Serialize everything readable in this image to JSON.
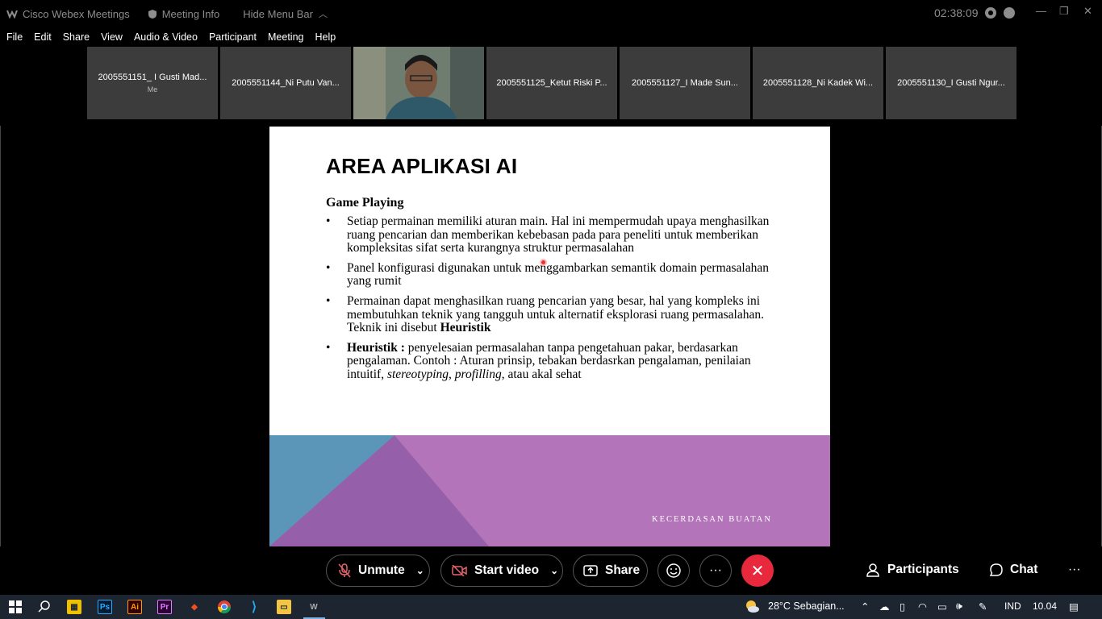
{
  "titlebar": {
    "app_name": "Cisco Webex Meetings",
    "meeting_info": "Meeting Info",
    "hide_menu": "Hide Menu Bar",
    "clock": "02:38:09"
  },
  "menu": [
    "File",
    "Edit",
    "Share",
    "View",
    "Audio & Video",
    "Participant",
    "Meeting",
    "Help"
  ],
  "participants": [
    {
      "name": "2005551151_ I Gusti Mad...",
      "sub": "Me",
      "video": false
    },
    {
      "name": "2005551144_Ni Putu Van...",
      "sub": "",
      "video": false
    },
    {
      "name": "",
      "sub": "",
      "video": true
    },
    {
      "name": "2005551125_Ketut Riski P...",
      "sub": "",
      "video": false
    },
    {
      "name": "2005551127_I Made Sun...",
      "sub": "",
      "video": false
    },
    {
      "name": "2005551128_Ni Kadek Wi...",
      "sub": "",
      "video": false
    },
    {
      "name": "2005551130_I Gusti Ngur...",
      "sub": "",
      "video": false
    }
  ],
  "slide": {
    "title": "AREA APLIKASI AI",
    "subtitle": "Game Playing",
    "b1": "Setiap permainan memiliki aturan main. Hal ini mempermudah upaya menghasilkan ruang pencarian dan memberikan kebebasan pada para peneliti untuk memberikan kompleksitas sifat serta kurangnya struktur permasalahan",
    "b2": "Panel konfigurasi digunakan untuk menggambarkan semantik domain permasalahan yang rumit",
    "b3_pre": "Permainan dapat menghasilkan ruang pencarian yang besar, hal yang kompleks ini membutuhkan teknik yang tangguh untuk alternatif eksplorasi ruang permasalahan. Teknik ini disebut ",
    "b3_bold": "Heuristik",
    "b4_bold": "Heuristik :",
    "b4_pre": " penyelesaian permasalahan tanpa pengetahuan pakar, berdasarkan pengalaman. Contoh : Aturan prinsip, tebakan berdasrkan pengalaman, penilaian intuitif, ",
    "b4_it1": "stereotyping",
    "b4_comma": ", ",
    "b4_it2": "profilling",
    "b4_post": ", atau akal sehat",
    "footer": "KECERDASAN BUATAN"
  },
  "controls": {
    "unmute": "Unmute",
    "start_video": "Start video",
    "share": "Share",
    "participants": "Participants",
    "chat": "Chat",
    "more": "···"
  },
  "taskbar": {
    "weather": "28°C  Sebagian...",
    "lang": "IND",
    "time": "10.04"
  },
  "colors": {
    "end_call": "#e8283c",
    "slide_footer_purple": "#b474b9",
    "slide_footer_blue": "#5b95b8",
    "slide_footer_dark": "#9560a9"
  }
}
